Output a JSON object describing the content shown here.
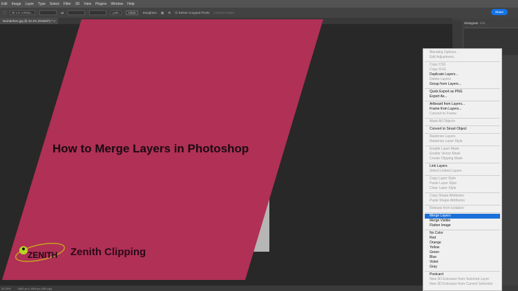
{
  "menubar": [
    "Edit",
    "Image",
    "Layer",
    "Type",
    "Select",
    "Filter",
    "3D",
    "View",
    "Plugins",
    "Window",
    "Help"
  ],
  "options": {
    "ratio": "W x H x Reso...",
    "units": "px/in",
    "clear": "Clear",
    "straighten": "Straighten",
    "delete_cropped": "Delete Cropped Pixels",
    "content_aware": "Content-Aware",
    "share": "Share"
  },
  "document_tab": "Nail-Before.jpg @ 33.3% (RGB/8*) *",
  "panel": {
    "histogram_tab": "Histogram",
    "info_tab": "Info"
  },
  "canvas": {
    "title": "How to Merge Layers in Photoshop",
    "brand": "Zenith Clipping",
    "logo_text": "ZENITH",
    "colors": {
      "banner": "#b03056",
      "canvas": "#282828"
    }
  },
  "status": {
    "zoom": "33.33%",
    "doc": "1800 px x 1800 px (300 ppi)"
  },
  "context_menu": [
    [
      {
        "l": "Blending Options...",
        "d": 1
      },
      {
        "l": "Edit Adjustment...",
        "d": 1
      }
    ],
    [
      {
        "l": "Copy CSS",
        "d": 1
      },
      {
        "l": "Copy SVG",
        "d": 1
      },
      {
        "l": "Duplicate Layers..."
      },
      {
        "l": "Delete Layers",
        "d": 1
      },
      {
        "l": "Group from Layers..."
      }
    ],
    [
      {
        "l": "Quick Export as PNG"
      },
      {
        "l": "Export As..."
      }
    ],
    [
      {
        "l": "Artboard from Layers..."
      },
      {
        "l": "Frame from Layers..."
      },
      {
        "l": "Convert to Frame",
        "d": 1
      }
    ],
    [
      {
        "l": "Mask All Objects",
        "d": 1
      }
    ],
    [
      {
        "l": "Convert to Smart Object"
      }
    ],
    [
      {
        "l": "Rasterize Layers",
        "d": 1
      },
      {
        "l": "Rasterize Layer Style",
        "d": 1
      }
    ],
    [
      {
        "l": "Enable Layer Mask",
        "d": 1
      },
      {
        "l": "Enable Vector Mask",
        "d": 1
      },
      {
        "l": "Create Clipping Mask",
        "d": 1
      }
    ],
    [
      {
        "l": "Link Layers"
      },
      {
        "l": "Select Linked Layers",
        "d": 1
      }
    ],
    [
      {
        "l": "Copy Layer Style",
        "d": 1
      },
      {
        "l": "Paste Layer Style",
        "d": 1
      },
      {
        "l": "Clear Layer Style",
        "d": 1
      }
    ],
    [
      {
        "l": "Copy Shape Attributes",
        "d": 1
      },
      {
        "l": "Paste Shape Attributes",
        "d": 1
      }
    ],
    [
      {
        "l": "Release from Isolation",
        "d": 1
      }
    ],
    [
      {
        "l": "Merge Layers",
        "s": 1
      },
      {
        "l": "Merge Visible"
      },
      {
        "l": "Flatten Image"
      }
    ],
    [
      {
        "l": "No Color"
      },
      {
        "l": "Red"
      },
      {
        "l": "Orange"
      },
      {
        "l": "Yellow"
      },
      {
        "l": "Green"
      },
      {
        "l": "Blue"
      },
      {
        "l": "Violet"
      },
      {
        "l": "Gray"
      }
    ],
    [
      {
        "l": "Postcard"
      },
      {
        "l": "New 3D Extrusion from Selected Layer",
        "d": 1
      },
      {
        "l": "New 3D Extrusion from Current Selection",
        "d": 1
      }
    ]
  ]
}
